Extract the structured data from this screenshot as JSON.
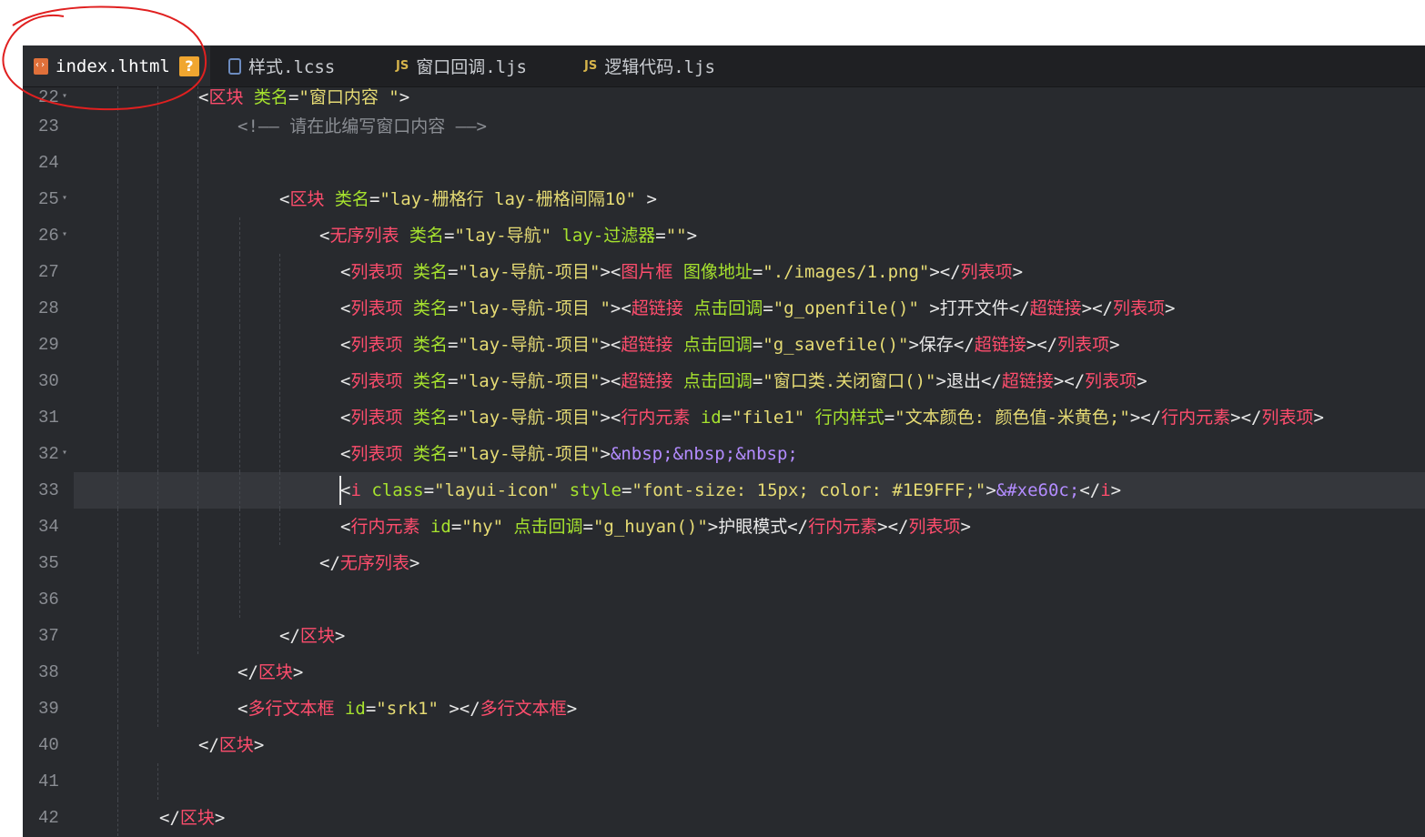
{
  "tabs": [
    {
      "label": "index.lhtml",
      "icon": "html-file-icon",
      "active": true,
      "badge": "?"
    },
    {
      "label": "样式.lcss",
      "icon": "css-file-icon",
      "active": false
    },
    {
      "label": "窗口回调.ljs",
      "icon": "js-file-icon",
      "icon_text": "JS",
      "active": false
    },
    {
      "label": "逻辑代码.ljs",
      "icon": "js-file-icon",
      "icon_text": "JS",
      "active": false
    }
  ],
  "current_line": 33,
  "lines": [
    {
      "n": "22",
      "fold": true,
      "indent": 1,
      "guides": 3,
      "tokens": [
        [
          "t",
          "<"
        ],
        [
          "tn",
          "区块"
        ],
        [
          "t",
          " "
        ],
        [
          "at",
          "类名"
        ],
        [
          "t",
          "="
        ],
        [
          "st",
          "\"窗口内容 \""
        ],
        [
          "t",
          ">"
        ]
      ]
    },
    {
      "n": "23",
      "fold": false,
      "indent": 2,
      "guides": 3,
      "tokens": [
        [
          "cm",
          "<!—— 请在此编写窗口内容 ——>"
        ]
      ]
    },
    {
      "n": "24",
      "fold": false,
      "indent": 2,
      "guides": 3,
      "tokens": []
    },
    {
      "n": "25",
      "fold": true,
      "indent": 3,
      "guides": 3,
      "tokens": [
        [
          "t",
          "<"
        ],
        [
          "tn",
          "区块"
        ],
        [
          "t",
          " "
        ],
        [
          "at",
          "类名"
        ],
        [
          "t",
          "="
        ],
        [
          "st",
          "\"lay-栅格行 lay-栅格间隔10\""
        ],
        [
          "t",
          " >"
        ]
      ]
    },
    {
      "n": "26",
      "fold": true,
      "indent": 4,
      "guides": 4,
      "tokens": [
        [
          "t",
          "<"
        ],
        [
          "tn",
          "无序列表"
        ],
        [
          "t",
          " "
        ],
        [
          "at",
          "类名"
        ],
        [
          "t",
          "="
        ],
        [
          "st",
          "\"lay-导航\""
        ],
        [
          "t",
          " "
        ],
        [
          "at",
          "lay-过滤器"
        ],
        [
          "t",
          "="
        ],
        [
          "st",
          "\"\""
        ],
        [
          "t",
          ">"
        ]
      ]
    },
    {
      "n": "27",
      "fold": false,
      "indent": 5,
      "guides": 5,
      "tokens": [
        [
          "t",
          "<"
        ],
        [
          "tn",
          "列表项"
        ],
        [
          "t",
          " "
        ],
        [
          "at",
          "类名"
        ],
        [
          "t",
          "="
        ],
        [
          "st",
          "\"lay-导航-项目\""
        ],
        [
          "t",
          "><"
        ],
        [
          "tn",
          "图片框"
        ],
        [
          "t",
          " "
        ],
        [
          "at",
          "图像地址"
        ],
        [
          "t",
          "="
        ],
        [
          "st",
          "\"./images/1.png\""
        ],
        [
          "t",
          "></"
        ],
        [
          "tn",
          "列表项"
        ],
        [
          "t",
          ">"
        ]
      ]
    },
    {
      "n": "28",
      "fold": false,
      "indent": 5,
      "guides": 5,
      "tokens": [
        [
          "t",
          "<"
        ],
        [
          "tn",
          "列表项"
        ],
        [
          "t",
          " "
        ],
        [
          "at",
          "类名"
        ],
        [
          "t",
          "="
        ],
        [
          "st",
          "\"lay-导航-项目 \""
        ],
        [
          "t",
          "><"
        ],
        [
          "tn",
          "超链接"
        ],
        [
          "t",
          " "
        ],
        [
          "at",
          "点击回调"
        ],
        [
          "t",
          "="
        ],
        [
          "st",
          "\"g_openfile()\""
        ],
        [
          "t",
          " >打开文件</"
        ],
        [
          "tn",
          "超链接"
        ],
        [
          "t",
          "></"
        ],
        [
          "tn",
          "列表项"
        ],
        [
          "t",
          ">"
        ]
      ]
    },
    {
      "n": "29",
      "fold": false,
      "indent": 5,
      "guides": 5,
      "tokens": [
        [
          "t",
          "<"
        ],
        [
          "tn",
          "列表项"
        ],
        [
          "t",
          " "
        ],
        [
          "at",
          "类名"
        ],
        [
          "t",
          "="
        ],
        [
          "st",
          "\"lay-导航-项目\""
        ],
        [
          "t",
          "><"
        ],
        [
          "tn",
          "超链接"
        ],
        [
          "t",
          " "
        ],
        [
          "at",
          "点击回调"
        ],
        [
          "t",
          "="
        ],
        [
          "st",
          "\"g_savefile()\""
        ],
        [
          "t",
          ">保存</"
        ],
        [
          "tn",
          "超链接"
        ],
        [
          "t",
          "></"
        ],
        [
          "tn",
          "列表项"
        ],
        [
          "t",
          ">"
        ]
      ]
    },
    {
      "n": "30",
      "fold": false,
      "indent": 5,
      "guides": 5,
      "tokens": [
        [
          "t",
          "<"
        ],
        [
          "tn",
          "列表项"
        ],
        [
          "t",
          " "
        ],
        [
          "at",
          "类名"
        ],
        [
          "t",
          "="
        ],
        [
          "st",
          "\"lay-导航-项目\""
        ],
        [
          "t",
          "><"
        ],
        [
          "tn",
          "超链接"
        ],
        [
          "t",
          " "
        ],
        [
          "at",
          "点击回调"
        ],
        [
          "t",
          "="
        ],
        [
          "st",
          "\"窗口类.关闭窗口()\""
        ],
        [
          "t",
          ">退出</"
        ],
        [
          "tn",
          "超链接"
        ],
        [
          "t",
          "></"
        ],
        [
          "tn",
          "列表项"
        ],
        [
          "t",
          ">"
        ]
      ]
    },
    {
      "n": "31",
      "fold": false,
      "indent": 5,
      "guides": 5,
      "tokens": [
        [
          "t",
          "<"
        ],
        [
          "tn",
          "列表项"
        ],
        [
          "t",
          " "
        ],
        [
          "at",
          "类名"
        ],
        [
          "t",
          "="
        ],
        [
          "st",
          "\"lay-导航-项目\""
        ],
        [
          "t",
          "><"
        ],
        [
          "tn",
          "行内元素"
        ],
        [
          "t",
          " "
        ],
        [
          "at",
          "id"
        ],
        [
          "t",
          "="
        ],
        [
          "st",
          "\"file1\""
        ],
        [
          "t",
          " "
        ],
        [
          "at",
          "行内样式"
        ],
        [
          "t",
          "="
        ],
        [
          "st",
          "\"文本颜色: 颜色值-米黄色;\""
        ],
        [
          "t",
          "></"
        ],
        [
          "tn",
          "行内元素"
        ],
        [
          "t",
          "></"
        ],
        [
          "tn",
          "列表项"
        ],
        [
          "t",
          ">"
        ]
      ]
    },
    {
      "n": "32",
      "fold": true,
      "indent": 5,
      "guides": 5,
      "tokens": [
        [
          "t",
          "<"
        ],
        [
          "tn",
          "列表项"
        ],
        [
          "t",
          " "
        ],
        [
          "at",
          "类名"
        ],
        [
          "t",
          "="
        ],
        [
          "st",
          "\"lay-导航-项目\""
        ],
        [
          "t",
          ">"
        ],
        [
          "en",
          "&nbsp;&nbsp;&nbsp;"
        ]
      ]
    },
    {
      "n": "33",
      "fold": false,
      "indent": 5,
      "guides": 5,
      "tokens": [
        [
          "t",
          "<"
        ],
        [
          "tn",
          "i"
        ],
        [
          "t",
          " "
        ],
        [
          "at",
          "class"
        ],
        [
          "t",
          "="
        ],
        [
          "st",
          "\"layui-icon\""
        ],
        [
          "t",
          " "
        ],
        [
          "at",
          "style"
        ],
        [
          "t",
          "="
        ],
        [
          "st",
          "\"font-size: 15px; color: #1E9FFF;\""
        ],
        [
          "t",
          ">"
        ],
        [
          "en",
          "&#xe60c;"
        ],
        [
          "t",
          "</"
        ],
        [
          "tn",
          "i"
        ],
        [
          "t",
          ">"
        ]
      ]
    },
    {
      "n": "34",
      "fold": false,
      "indent": 5,
      "guides": 5,
      "tokens": [
        [
          "t",
          "<"
        ],
        [
          "tn",
          "行内元素"
        ],
        [
          "t",
          " "
        ],
        [
          "at",
          "id"
        ],
        [
          "t",
          "="
        ],
        [
          "st",
          "\"hy\""
        ],
        [
          "t",
          " "
        ],
        [
          "at",
          "点击回调"
        ],
        [
          "t",
          "="
        ],
        [
          "st",
          "\"g_huyan()\""
        ],
        [
          "t",
          ">护眼模式</"
        ],
        [
          "tn",
          "行内元素"
        ],
        [
          "t",
          "></"
        ],
        [
          "tn",
          "列表项"
        ],
        [
          "t",
          ">"
        ]
      ]
    },
    {
      "n": "35",
      "fold": false,
      "indent": 4,
      "guides": 4,
      "tokens": [
        [
          "t",
          "</"
        ],
        [
          "tn",
          "无序列表"
        ],
        [
          "t",
          ">"
        ]
      ]
    },
    {
      "n": "36",
      "fold": false,
      "indent": 4,
      "guides": 4,
      "tokens": []
    },
    {
      "n": "37",
      "fold": false,
      "indent": 3,
      "guides": 3,
      "tokens": [
        [
          "t",
          "</"
        ],
        [
          "tn",
          "区块"
        ],
        [
          "t",
          ">"
        ]
      ]
    },
    {
      "n": "38",
      "fold": false,
      "indent": 2,
      "guides": 2,
      "tokens": [
        [
          "t",
          "</"
        ],
        [
          "tn",
          "区块"
        ],
        [
          "t",
          ">"
        ]
      ]
    },
    {
      "n": "39",
      "fold": false,
      "indent": 2,
      "guides": 2,
      "tokens": [
        [
          "t",
          "<"
        ],
        [
          "tn",
          "多行文本框"
        ],
        [
          "t",
          " "
        ],
        [
          "at",
          "id"
        ],
        [
          "t",
          "="
        ],
        [
          "st",
          "\"srk1\""
        ],
        [
          "t",
          " ></"
        ],
        [
          "tn",
          "多行文本框"
        ],
        [
          "t",
          ">"
        ]
      ]
    },
    {
      "n": "40",
      "fold": false,
      "indent": 1,
      "guides": 1,
      "tokens": [
        [
          "t",
          "</"
        ],
        [
          "tn",
          "区块"
        ],
        [
          "t",
          ">"
        ]
      ]
    },
    {
      "n": "41",
      "fold": false,
      "indent": 1,
      "guides": 2,
      "tokens": []
    },
    {
      "n": "42",
      "fold": false,
      "indent": 0,
      "guides": 1,
      "tokens": [
        [
          "t",
          "</"
        ],
        [
          "tn",
          "区块"
        ],
        [
          "t",
          ">"
        ]
      ]
    }
  ]
}
